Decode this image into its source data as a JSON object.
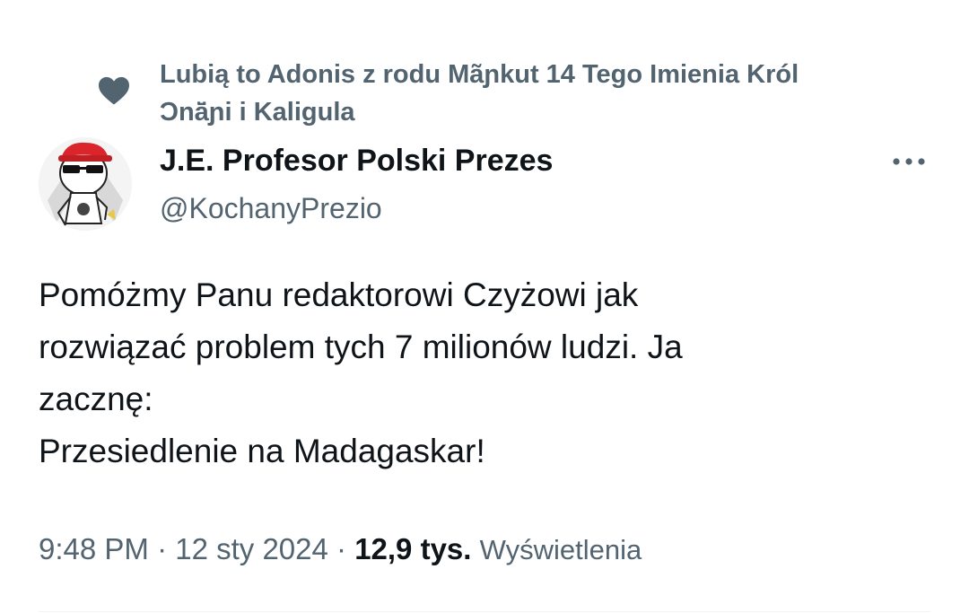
{
  "social_context": {
    "line1": "Lubią to Adonis z rodu Mãɲkut 14 Tego Imienia Król",
    "line2": "Ɔnā̈ɲi i Kaligula",
    "icon": "heart-icon"
  },
  "author": {
    "display_name": "J.E. Profesor Polski Prezes",
    "handle": "@KochanyPrezio"
  },
  "tweet": {
    "lines": [
      "Pomóżmy Panu redaktorowi Czyżowi jak",
      "rozwiązać problem tych 7 milionów ludzi. Ja",
      "zacznę:",
      "Przesiedlenie na Madagaskar!"
    ]
  },
  "meta": {
    "time": "9:48 PM",
    "separator": " · ",
    "date": "12 sty 2024",
    "views_count": "12,9 tys.",
    "views_label": "Wyświetlenia"
  },
  "colors": {
    "secondary_text": "#536471",
    "primary_text": "#0f1419"
  }
}
